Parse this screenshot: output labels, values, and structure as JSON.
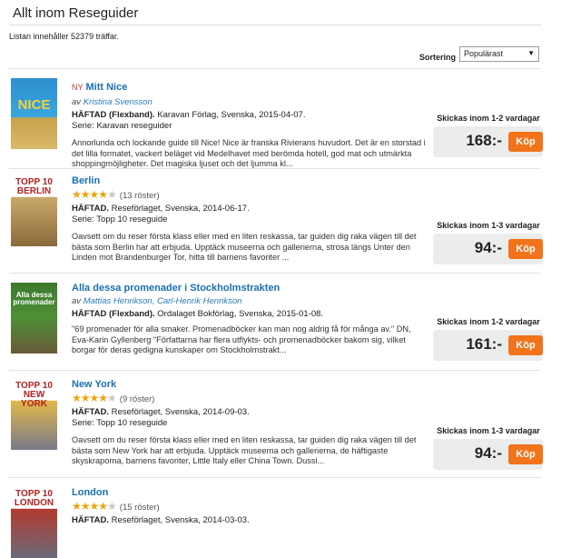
{
  "header": {
    "title": "Allt inom Reseguider",
    "result_count": "Listan innehåller 52379 träffar.",
    "sort_label": "Sortering",
    "sort_value": "Populärast"
  },
  "products": [
    {
      "new_badge": "NY",
      "title": "Mitt Nice",
      "byline_prefix": "av",
      "authors": "Kristina Svensson",
      "format": "HÄFTAD (Flexband).",
      "pub": "Karavan Förlag, Svenska, 2015-04-07.",
      "series": "Serie: Karavan reseguider",
      "description": "Annorlunda och lockande guide till Nice! Nice är franska Rivierans huvudort. Det är en storstad i det lilla formatet, vackert beläget vid Medelhavet med berömda hotell, god mat och utmärkta shoppingmöjligheter. Det magiska ljuset och det ljumma kl...",
      "shipping": "Skickas inom 1-2 vardagar",
      "price": "168:-",
      "buy": "Köp",
      "cover_word": "NICE",
      "cover_color": "#3a9fd5"
    },
    {
      "title": "Berlin",
      "rating": 4,
      "votes": "(13 röster)",
      "format": "HÄFTAD.",
      "pub": "Reseförlaget, Svenska, 2014-06-17.",
      "series": "Serie: Topp 10 reseguide",
      "description": "Oavsett om du reser första klass eller med en liten reskassa, tar guiden dig raka vägen till det bästa som Berlin har att erbjuda. Upptäck museerna och gallerierna, strosa längs Unter den Linden mot Brandenburger Tor, hitta till barnens favoriter ...",
      "shipping": "Skickas inom 1-3 vardagar",
      "price": "94:-",
      "buy": "Köp",
      "cover_word": "TOPP 10 BERLIN",
      "cover_color": "#8a6a3a"
    },
    {
      "title": "Alla dessa promenader i Stockholmstrakten",
      "byline_prefix": "av",
      "authors": "Mattias Henrikson, Carl-Henrik Henrikson",
      "format": "HÄFTAD (Flexband).",
      "pub": "Ordalaget Bokförlag, Svenska, 2015-01-08.",
      "description": "\"69 promenader för alla smaker. Promenadböcker kan man nog aldrig få för många av.\" DN, Eva-Karin Gyllenberg \"Författarna har flera utflykts- och promenadböcker bakom sig, vilket borgar för deras gedigna kunskaper om Stockholmstrakt...",
      "shipping": "Skickas inom 1-2 vardagar",
      "price": "161:-",
      "buy": "Köp",
      "cover_word": "Alla dessa promenader",
      "cover_color": "#3d7a2e"
    },
    {
      "title": "New York",
      "rating": 4,
      "votes": "(9 röster)",
      "format": "HÄFTAD.",
      "pub": "Reseförlaget, Svenska, 2014-09-03.",
      "series": "Serie: Topp 10 reseguide",
      "description": "Oavsett om du reser första klass eller med en liten reskassa, tar guiden dig raka vägen till det bästa som New York har att erbjuda. Upptäck museerna och gallerierna, de häftigaste skyskraporna, barnens favoriter, Little Italy eller China Town. Dussi...",
      "shipping": "Skickas inom 1-3 vardagar",
      "price": "94:-",
      "buy": "Köp",
      "cover_word": "TOPP 10 NEW YORK",
      "cover_color": "#c99a2e"
    },
    {
      "title": "London",
      "rating": 4,
      "votes": "(15 röster)",
      "format": "HÄFTAD.",
      "pub": "Reseförlaget, Svenska, 2014-03-03.",
      "cover_word": "TOPP 10 LONDON",
      "cover_color": "#b23a2e"
    }
  ],
  "colors": {
    "link": "#1a6faf",
    "buy_button": "#f27319",
    "star": "#f0a30a"
  }
}
